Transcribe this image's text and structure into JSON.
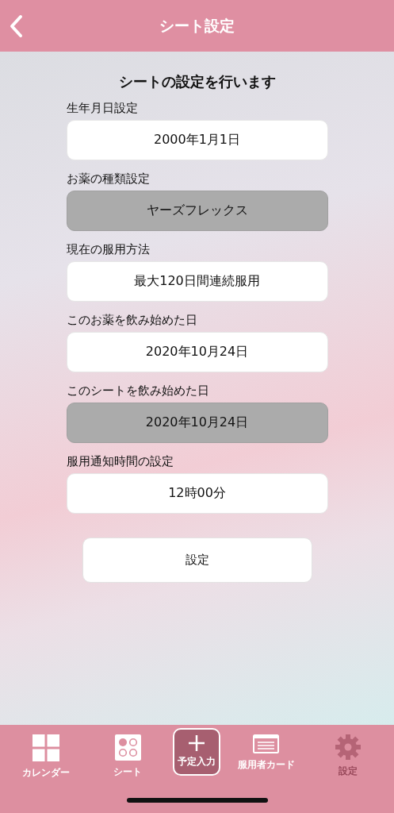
{
  "header": {
    "title": "シート設定"
  },
  "heading": "シートの設定を行います",
  "fields": [
    {
      "label": "生年月日設定",
      "value": "2000年1月1日",
      "disabled": false
    },
    {
      "label": "お薬の種類設定",
      "value": "ヤーズフレックス",
      "disabled": true
    },
    {
      "label": "現在の服用方法",
      "value": "最大120日間連続服用",
      "disabled": false
    },
    {
      "label": "このお薬を飲み始めた日",
      "value": "2020年10月24日",
      "disabled": false
    },
    {
      "label": "このシートを飲み始めた日",
      "value": "2020年10月24日",
      "disabled": true
    },
    {
      "label": "服用通知時間の設定",
      "value": "12時00分",
      "disabled": false
    }
  ],
  "submit": "設定",
  "tabs": [
    {
      "kind": "calendar",
      "label": "カレンダー",
      "selected": false
    },
    {
      "kind": "sheet",
      "label": "シート",
      "selected": false
    },
    {
      "kind": "add",
      "label": "予定入力",
      "selected": false
    },
    {
      "kind": "card",
      "label": "服用者カード",
      "selected": false
    },
    {
      "kind": "settings",
      "label": "設定",
      "selected": true
    }
  ]
}
